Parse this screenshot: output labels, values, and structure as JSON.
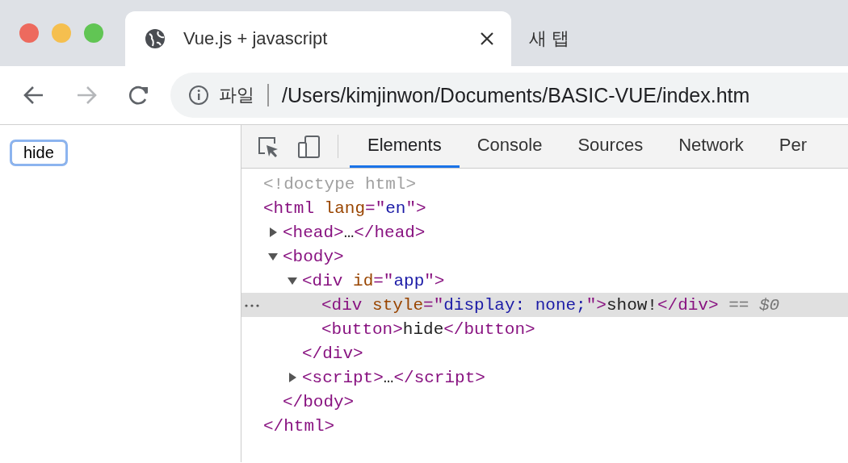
{
  "tabs": [
    {
      "title": "Vue.js + javascript",
      "selected": true
    },
    {
      "title": "새 탭",
      "selected": false
    }
  ],
  "navigation": [
    {
      "kind": "back",
      "disabled": false
    },
    {
      "kind": "forward",
      "disabled": true
    },
    {
      "kind": "reload",
      "disabled": false
    }
  ],
  "address_bar": {
    "scheme": "파일",
    "url": "/Users/kimjinwon/Documents/BASIC-VUE/index.htm"
  },
  "page": {
    "button": "hide",
    "focused": true
  },
  "devtools": {
    "tabs": [
      {
        "label": "Elements",
        "selected": true
      },
      {
        "label": "Console",
        "selected": false
      },
      {
        "label": "Sources",
        "selected": false
      },
      {
        "label": "Network",
        "selected": false
      },
      {
        "label": "Per",
        "selected": false
      }
    ],
    "dom": [
      {
        "selected": false,
        "line": [
          {
            "kind": "doctype",
            "text": "<!doctype html>"
          }
        ]
      },
      {
        "selected": false,
        "line": [
          {
            "kind": "tag",
            "text": "<html"
          },
          {
            "kind": "attr",
            "text": " lang"
          },
          {
            "kind": "tag",
            "text": "=\""
          },
          {
            "kind": "value",
            "text": "en"
          },
          {
            "kind": "tag",
            "text": "\">"
          }
        ],
        "children": [
          {
            "selected": false,
            "expanded": false,
            "line": [
              {
                "kind": "tag",
                "text": "<head>"
              },
              {
                "kind": "content",
                "text": "…"
              },
              {
                "kind": "tag",
                "text": "</head>"
              }
            ]
          },
          {
            "selected": false,
            "expanded": true,
            "line": [
              {
                "kind": "tag",
                "text": "<body>"
              }
            ],
            "children": [
              {
                "selected": false,
                "expanded": true,
                "line": [
                  {
                    "kind": "tag",
                    "text": "<div"
                  },
                  {
                    "kind": "attr",
                    "text": " id"
                  },
                  {
                    "kind": "tag",
                    "text": "=\""
                  },
                  {
                    "kind": "value",
                    "text": "app"
                  },
                  {
                    "kind": "tag",
                    "text": "\">"
                  }
                ],
                "children": [
                  {
                    "selected": true,
                    "line": [
                      {
                        "kind": "tag",
                        "text": "<div"
                      },
                      {
                        "kind": "attr",
                        "text": " style"
                      },
                      {
                        "kind": "tag",
                        "text": "=\""
                      },
                      {
                        "kind": "value",
                        "text": "display: none;"
                      },
                      {
                        "kind": "tag",
                        "text": "\">"
                      },
                      {
                        "kind": "content",
                        "text": "show!"
                      },
                      {
                        "kind": "tag",
                        "text": "</div>"
                      },
                      {
                        "kind": "ref",
                        "text": " == $0"
                      }
                    ]
                  },
                  {
                    "selected": false,
                    "line": [
                      {
                        "kind": "tag",
                        "text": "<button>"
                      },
                      {
                        "kind": "content",
                        "text": "hide"
                      },
                      {
                        "kind": "tag",
                        "text": "</button>"
                      }
                    ]
                  }
                ],
                "end": [
                  {
                    "kind": "tag",
                    "text": "</div>"
                  }
                ]
              },
              {
                "selected": false,
                "expanded": false,
                "line": [
                  {
                    "kind": "tag",
                    "text": "<script>"
                  },
                  {
                    "kind": "content",
                    "text": "…"
                  },
                  {
                    "kind": "tag",
                    "text": "</script>"
                  }
                ]
              }
            ],
            "end": [
              {
                "kind": "tag",
                "text": "</body>"
              }
            ]
          }
        ],
        "end": [
          {
            "kind": "tag",
            "text": "</html>"
          }
        ]
      }
    ]
  }
}
